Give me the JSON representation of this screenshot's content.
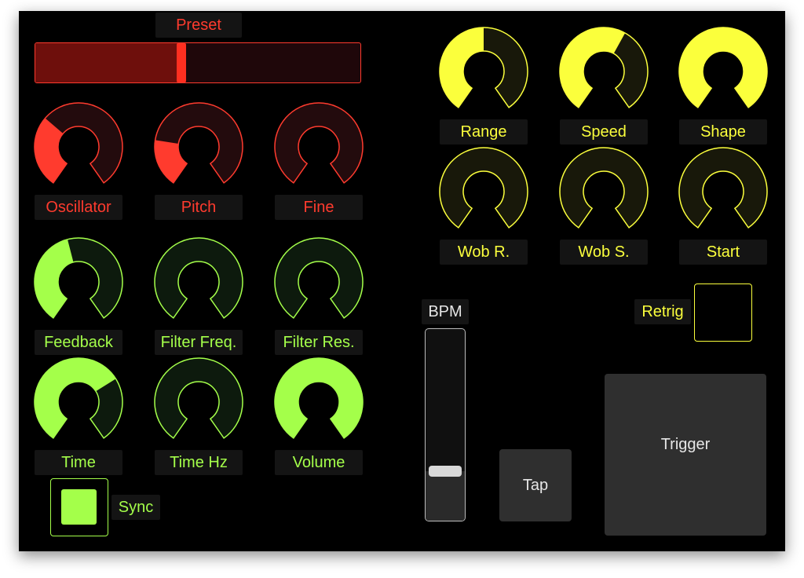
{
  "colors": {
    "red": "#ff3b2e",
    "green": "#a4ff4a",
    "yellow": "#fbff3c",
    "gray": "#d0d0d0"
  },
  "preset": {
    "label": "Preset",
    "value": 0.45
  },
  "knobs": [
    {
      "id": "oscillator",
      "label": "Oscillator",
      "color": "red",
      "value": 0.33
    },
    {
      "id": "pitch",
      "label": "Pitch",
      "color": "red",
      "value": 0.22
    },
    {
      "id": "fine",
      "label": "Fine",
      "color": "red",
      "value": 0.0
    },
    {
      "id": "feedback",
      "label": "Feedback",
      "color": "green",
      "value": 0.45
    },
    {
      "id": "filter-freq",
      "label": "Filter Freq.",
      "color": "green",
      "value": 0.0
    },
    {
      "id": "filter-res",
      "label": "Filter Res.",
      "color": "green",
      "value": 0.0
    },
    {
      "id": "time",
      "label": "Time",
      "color": "green",
      "value": 0.7
    },
    {
      "id": "time-hz",
      "label": "Time Hz",
      "color": "green",
      "value": 0.0
    },
    {
      "id": "volume",
      "label": "Volume",
      "color": "green",
      "value": 1.0
    },
    {
      "id": "range",
      "label": "Range",
      "color": "yellow",
      "value": 0.5
    },
    {
      "id": "speed",
      "label": "Speed",
      "color": "yellow",
      "value": 0.6
    },
    {
      "id": "shape",
      "label": "Shape",
      "color": "yellow",
      "value": 1.0
    },
    {
      "id": "wob-r",
      "label": "Wob R.",
      "color": "yellow",
      "value": 0.0
    },
    {
      "id": "wob-s",
      "label": "Wob S.",
      "color": "yellow",
      "value": 0.0
    },
    {
      "id": "start",
      "label": "Start",
      "color": "yellow",
      "value": 0.0
    }
  ],
  "sync": {
    "label": "Sync",
    "on": true
  },
  "bpm": {
    "label": "BPM",
    "value": 0.26
  },
  "retrig": {
    "label": "Retrig",
    "on": false
  },
  "tap": {
    "label": "Tap"
  },
  "trigger": {
    "label": "Trigger"
  }
}
